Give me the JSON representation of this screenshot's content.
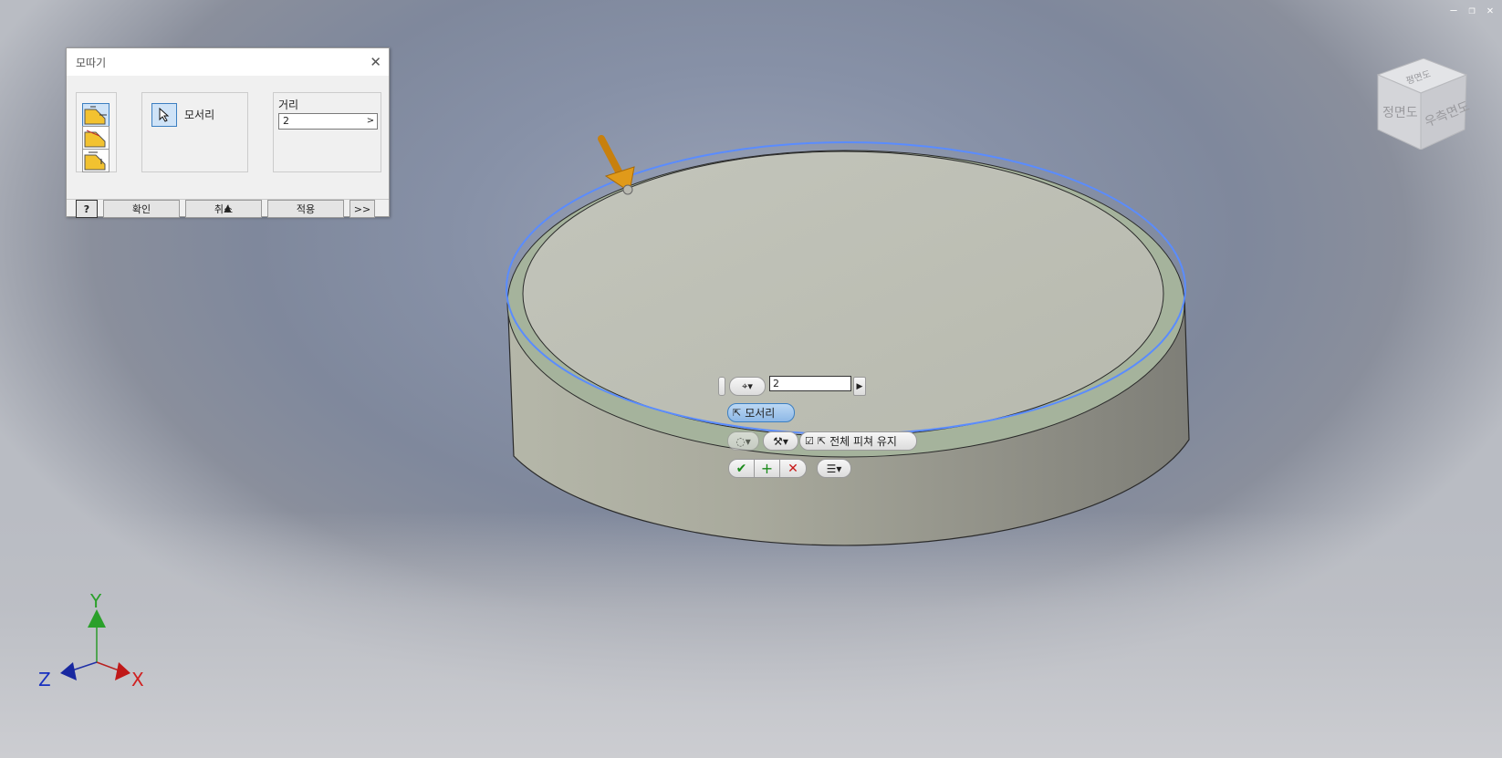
{
  "dialog": {
    "title": "모따기",
    "selection_label": "모서리",
    "distance_label": "거리",
    "distance_value": "2",
    "help_label": "?",
    "ok_label": "확인",
    "cancel_label": "취소",
    "apply_label": "적용",
    "more_label": ">>",
    "collapse_label": "▲"
  },
  "minitoolbar": {
    "distance_value": "2",
    "edge_label": "모서리",
    "preserve_label": "전체 피쳐 유지"
  },
  "viewcube": {
    "top_label": "평면도",
    "front_label": "정면도",
    "right_label": "우측면도"
  },
  "triad": {
    "x": "X",
    "y": "Y",
    "z": "Z"
  },
  "colors": {
    "accent": "#3c7fc1",
    "edge_highlight": "#5a8cff",
    "arrow": "#d68a10"
  }
}
